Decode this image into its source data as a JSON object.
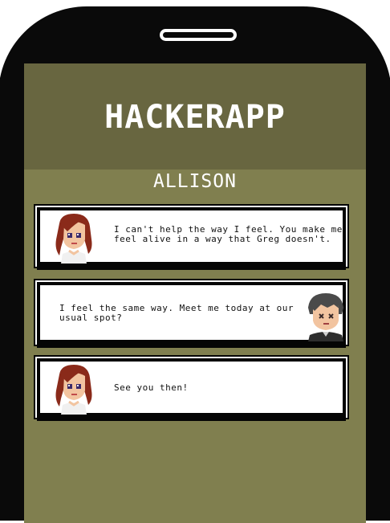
{
  "app": {
    "title": "HACKERAPP"
  },
  "contact": {
    "name": "ALLISON"
  },
  "messages": [
    {
      "sender": "allison",
      "text": "I can't help the way I feel. You make me feel alive in a way that Greg doesn't."
    },
    {
      "sender": "player",
      "text": "I feel the same way. Meet me today at our usual spot?"
    },
    {
      "sender": "allison",
      "text": "See you then!"
    }
  ],
  "colors": {
    "header": "#686640",
    "chat_bg": "#807f4f",
    "phone": "#0a0a0a",
    "bubble": "#ffffff"
  }
}
